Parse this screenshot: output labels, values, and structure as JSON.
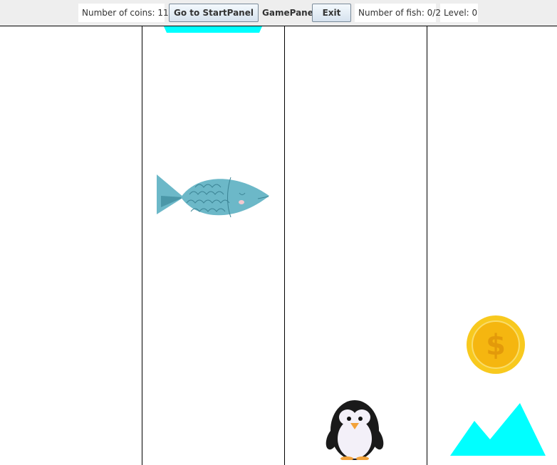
{
  "toolbar": {
    "coins_text": "Number of coins: 11",
    "start_button_label": "Go to StartPanel",
    "panel_name": "GamePanel",
    "exit_button_label": "Exit",
    "fish_text": "Number of fish: 0/2",
    "level_text": "Level: 0"
  },
  "game": {
    "lanes": 4,
    "sprites": [
      {
        "type": "obstacle",
        "icon": "cyan-triangle-obstacle-icon",
        "lane": 2
      },
      {
        "type": "fish",
        "icon": "fish-icon",
        "lane": 2
      },
      {
        "type": "coin",
        "icon": "coin-icon",
        "symbol": "$",
        "lane": 4
      },
      {
        "type": "player",
        "icon": "penguin-icon",
        "lane": 3
      },
      {
        "type": "obstacle",
        "icon": "mountain-obstacle-icon",
        "lane": 4
      }
    ],
    "colors": {
      "obstacle": "#00ffff",
      "fish": "#6cb8c8",
      "coin": "#f6c619",
      "penguin": "#111111"
    }
  }
}
